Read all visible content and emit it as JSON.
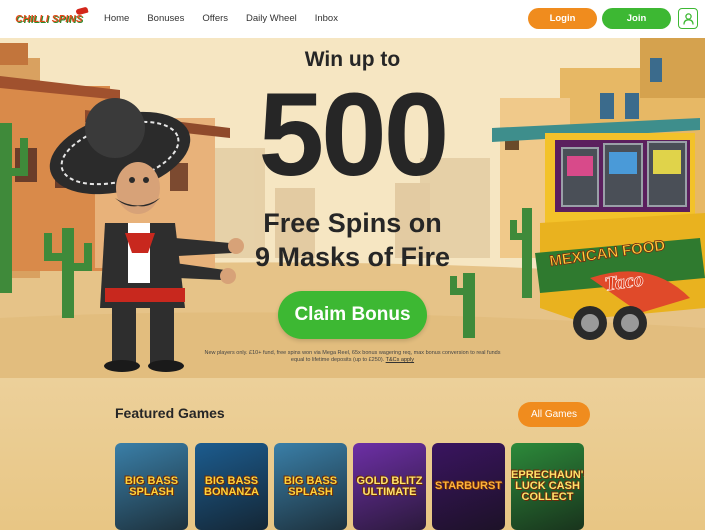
{
  "header": {
    "logo_text": "CHILLI SPINS",
    "nav": [
      "Home",
      "Bonuses",
      "Offers",
      "Daily Wheel",
      "Inbox"
    ],
    "login_label": "Login",
    "join_label": "Join",
    "user_icon": "user-icon"
  },
  "hero": {
    "headline_small": "Win up to",
    "headline_number": "500",
    "sub_line1": "Free Spins on",
    "sub_line2": "9 Masks of Fire",
    "cta_label": "Claim Bonus",
    "terms_line1": "New players only. £10+ fund, free spins won via Mega Reel, 65x bonus wagering req, max bonus conversion to real funds",
    "terms_line2": "equal to lifetime deposits (up to £250).",
    "terms_link": "T&Cs apply",
    "truck_sign": "MEXICAN FOOD",
    "truck_sign2": "Taco"
  },
  "featured": {
    "title": "Featured Games",
    "all_label": "All Games",
    "games": [
      {
        "name": "BIG BASS SPLASH",
        "bg": "#3a7fa8",
        "fg": "#ffd33a"
      },
      {
        "name": "BIG BASS BONANZA",
        "bg": "#1c5c8f",
        "fg": "#ffd33a"
      },
      {
        "name": "BIG BASS SPLASH",
        "bg": "#3a7fa8",
        "fg": "#ffd33a"
      },
      {
        "name": "GOLD BLITZ ULTIMATE",
        "bg": "#6d2fa6",
        "fg": "#ffe36b"
      },
      {
        "name": "STARBURST",
        "bg": "#3a1460",
        "fg": "#ffb23a"
      },
      {
        "name": "LEPRECHAUN'S LUCK CASH COLLECT",
        "bg": "#2c8a3a",
        "fg": "#ffe36b"
      }
    ]
  },
  "colors": {
    "green": "#3db833",
    "orange": "#f08c1e",
    "text_dark": "#262626"
  }
}
